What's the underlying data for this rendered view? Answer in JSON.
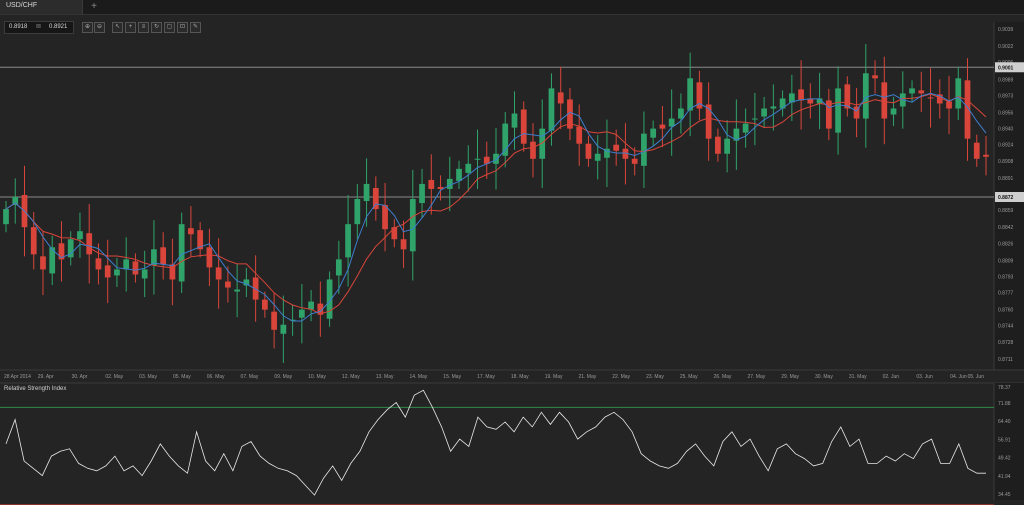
{
  "tab": {
    "symbol": "USD/CHF",
    "add_label": "+"
  },
  "quote": {
    "bid": "0.8918",
    "separator": "⊠",
    "ask": "0.8921"
  },
  "toolbar": {
    "icons": [
      "zoom-in-icon",
      "zoom-out-icon",
      "cursor-icon",
      "crosshair-icon",
      "indicators-icon",
      "refresh-icon",
      "screenshot-icon",
      "chart-type-icon",
      "draw-icon"
    ],
    "glyphs": [
      "⊕",
      "⊖",
      "↖",
      "+",
      "≡",
      "↻",
      "▢",
      "⊡",
      "✎"
    ]
  },
  "colors": {
    "background": "#242424",
    "up_candle": "#2fa36a",
    "down_candle": "#d9453a",
    "ma_fast": "#3d7fcf",
    "ma_slow": "#d9453a",
    "rsi_line": "#e8e8e8",
    "rsi_upper": "#2f8a4a",
    "rsi_lower": "#c0392b",
    "hline": "#8a8a8a"
  },
  "chart_data": [
    {
      "type": "candlestick",
      "symbol": "USD/CHF",
      "ylim": [
        0.87,
        0.9046
      ],
      "y_ticks": [
        "0.9039",
        "0.9022",
        "0.9006",
        "0.8989",
        "0.8973",
        "0.8956",
        "0.8940",
        "0.8924",
        "0.8908",
        "0.8891",
        "0.8875",
        "0.8859",
        "0.8842",
        "0.8826",
        "0.8809",
        "0.8793",
        "0.8777",
        "0.8760",
        "0.8744",
        "0.8728",
        "0.8711"
      ],
      "x_ticks": [
        "28 Apr 2014",
        "29. Apr",
        "30. Apr",
        "02. May",
        "03. May",
        "05. May",
        "06. May",
        "07. May",
        "09. May",
        "10. May",
        "12. May",
        "13. May",
        "14. May",
        "15. May",
        "17. May",
        "18. May",
        "19. May",
        "21. May",
        "22. May",
        "23. May",
        "25. May",
        "26. May",
        "27. May",
        "29. May",
        "30. May",
        "31. May",
        "02. Jun",
        "03. Jun",
        "04. Jun",
        "05. Jun"
      ],
      "horizontal_lines": [
        {
          "label": "0.9001",
          "value": 0.9001
        },
        {
          "label": "0.8872",
          "value": 0.8872
        }
      ],
      "close_path": [
        0.886,
        0.8872,
        0.8842,
        0.8815,
        0.88,
        0.8822,
        0.881,
        0.883,
        0.8838,
        0.8815,
        0.88,
        0.8792,
        0.88,
        0.881,
        0.8795,
        0.88,
        0.882,
        0.8805,
        0.879,
        0.8845,
        0.8835,
        0.882,
        0.8802,
        0.879,
        0.8782,
        0.878,
        0.879,
        0.877,
        0.876,
        0.874,
        0.8745,
        0.875,
        0.876,
        0.8768,
        0.8755,
        0.879,
        0.881,
        0.8845,
        0.887,
        0.8885,
        0.886,
        0.884,
        0.883,
        0.882,
        0.887,
        0.8885,
        0.888,
        0.888,
        0.889,
        0.89,
        0.8905,
        0.891,
        0.8905,
        0.8915,
        0.8945,
        0.8955,
        0.8925,
        0.891,
        0.894,
        0.898,
        0.8965,
        0.894,
        0.8925,
        0.891,
        0.8915,
        0.892,
        0.8918,
        0.891,
        0.8905,
        0.8935,
        0.894,
        0.894,
        0.895,
        0.896,
        0.899,
        0.896,
        0.893,
        0.8915,
        0.893,
        0.894,
        0.8945,
        0.895,
        0.896,
        0.8962,
        0.897,
        0.8975,
        0.8968,
        0.8965,
        0.897,
        0.894,
        0.898,
        0.896,
        0.895,
        0.8995,
        0.899,
        0.895,
        0.896,
        0.8975,
        0.898,
        0.8975,
        0.897,
        0.8965,
        0.896,
        0.899,
        0.893,
        0.891,
        0.8912
      ],
      "rsi": {
        "title": "Relative Strength Index",
        "ylim": [
          32,
          80
        ],
        "y_ticks": [
          "78.37",
          "71.88",
          "64.40",
          "56.91",
          "49.42",
          "41.94",
          "34.45"
        ],
        "upper_level": 70,
        "lower_level": 30,
        "values": [
          55,
          65,
          48,
          45,
          42,
          50,
          52,
          53,
          47,
          45,
          44,
          46,
          50,
          44,
          46,
          42,
          48,
          55,
          50,
          46,
          43,
          60,
          48,
          44,
          51,
          44,
          54,
          56,
          50,
          47,
          45,
          44,
          42,
          38,
          34,
          41,
          46,
          40,
          47,
          52,
          60,
          65,
          69,
          72,
          66,
          75,
          77,
          70,
          62,
          52,
          57,
          54,
          66,
          62,
          61,
          64,
          60,
          66,
          62,
          68,
          63,
          68,
          64,
          57,
          60,
          62,
          66,
          68,
          65,
          60,
          51,
          48,
          46,
          45,
          47,
          52,
          55,
          50,
          46,
          56,
          60,
          54,
          57,
          50,
          44,
          53,
          55,
          51,
          49,
          46,
          47,
          56,
          62,
          54,
          57,
          47,
          47,
          50,
          48,
          51,
          49,
          55,
          57,
          47,
          47,
          55,
          45,
          43,
          43
        ]
      }
    }
  ]
}
